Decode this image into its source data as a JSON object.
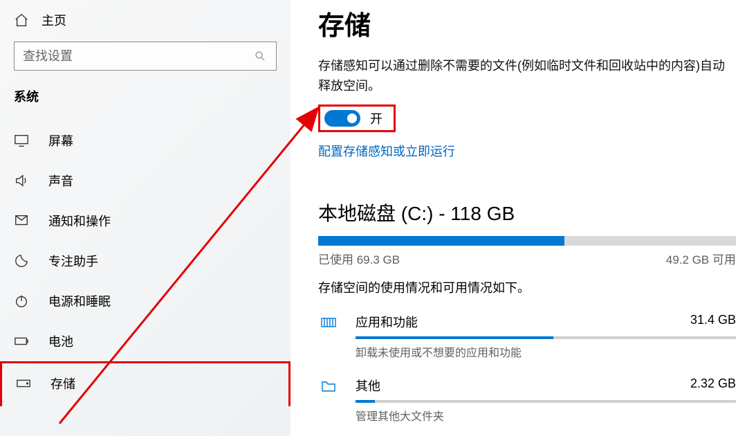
{
  "sidebar": {
    "home": "主页",
    "search_placeholder": "查找设置",
    "section": "系统",
    "items": [
      {
        "label": "屏幕"
      },
      {
        "label": "声音"
      },
      {
        "label": "通知和操作"
      },
      {
        "label": "专注助手"
      },
      {
        "label": "电源和睡眠"
      },
      {
        "label": "电池"
      },
      {
        "label": "存储"
      }
    ]
  },
  "main": {
    "title": "存储",
    "storage_sense_desc": "存储感知可以通过删除不需要的文件(例如临时文件和回收站中的内容)自动释放空间。",
    "toggle_label": "开",
    "config_link": "配置存储感知或立即运行",
    "disk_title": "本地磁盘 (C:) - 118 GB",
    "used_text": "已使用 69.3 GB",
    "free_text": "49.2 GB 可用",
    "used_percent": 59,
    "usage_note": "存储空间的使用情况和可用情况如下。",
    "categories": [
      {
        "name": "应用和功能",
        "size": "31.4 GB",
        "sub": "卸载未使用或不想要的应用和功能",
        "percent": 52
      },
      {
        "name": "其他",
        "size": "2.32 GB",
        "sub": "管理其他大文件夹",
        "percent": 5
      }
    ]
  }
}
